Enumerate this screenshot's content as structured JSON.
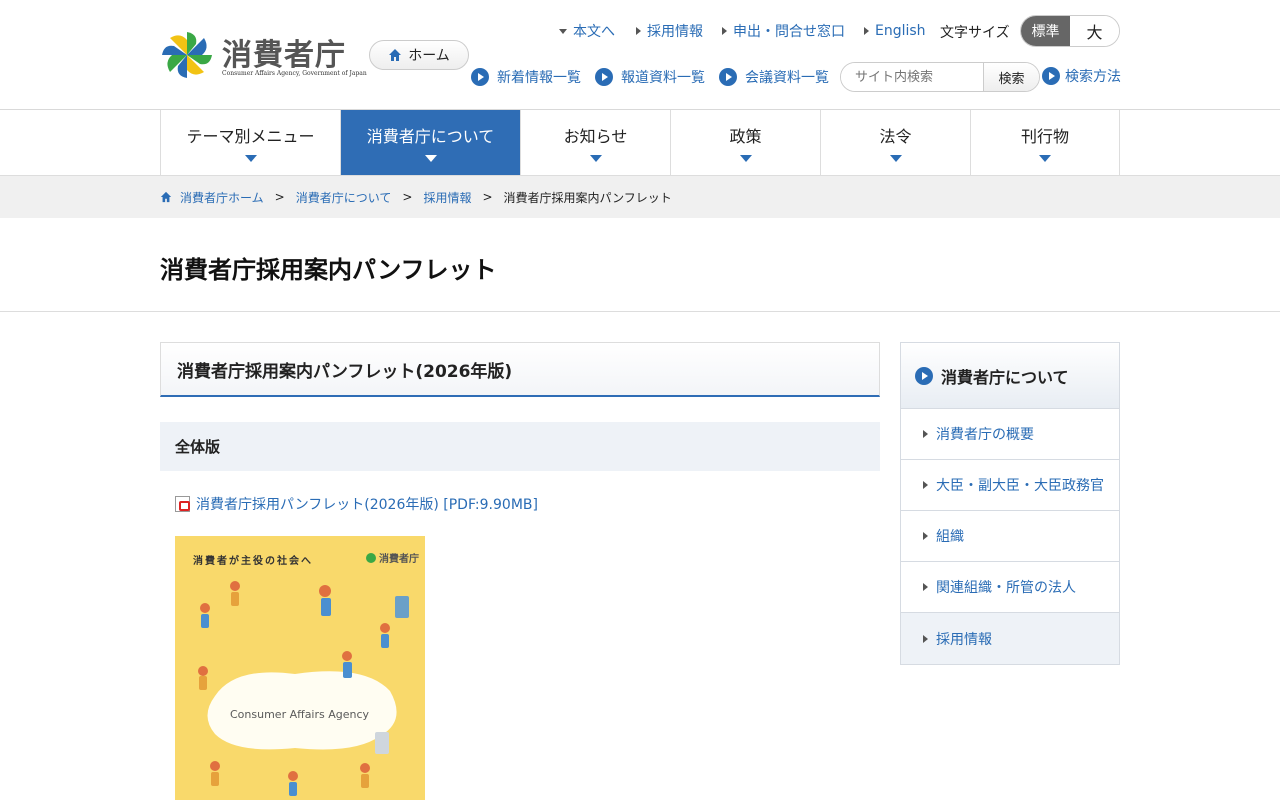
{
  "header": {
    "logo_text": "消費者庁",
    "logo_sub": "Consumer Affairs Agency, Government of Japan",
    "home_label": "ホーム",
    "utility_links": [
      "本文へ",
      "採用情報",
      "申出・問合せ窓口",
      "English"
    ],
    "font_size_label": "文字サイズ",
    "font_size_standard": "標準",
    "font_size_large": "大",
    "news_links": [
      "新着情報一覧",
      "報道資料一覧",
      "会議資料一覧"
    ],
    "search_placeholder": "サイト内検索",
    "search_button": "検索",
    "search_help": "検索方法"
  },
  "gnav": [
    "テーマ別メニュー",
    "消費者庁について",
    "お知らせ",
    "政策",
    "法令",
    "刊行物"
  ],
  "breadcrumb": [
    "消費者庁ホーム",
    "消費者庁について",
    "採用情報",
    "消費者庁採用案内パンフレット"
  ],
  "page_title": "消費者庁採用案内パンフレット",
  "main": {
    "section_title": "消費者庁採用案内パンフレット(2026年版)",
    "sub_title": "全体版",
    "pdf_link": "消費者庁採用パンフレット(2026年版) [PDF:9.90MB]",
    "cover_top_text": "消費者が主役の社会へ",
    "cover_logo": "消費者庁",
    "cover_title": "Consumer Affairs Agency"
  },
  "side": {
    "title": "消費者庁について",
    "items": [
      "消費者庁の概要",
      "大臣・副大臣・大臣政務官",
      "組織",
      "関連組織・所管の法人",
      "採用情報"
    ]
  },
  "colors": {
    "accent": "#2f6db5",
    "link": "#2a6cb5",
    "cover": "#f9d96b"
  }
}
